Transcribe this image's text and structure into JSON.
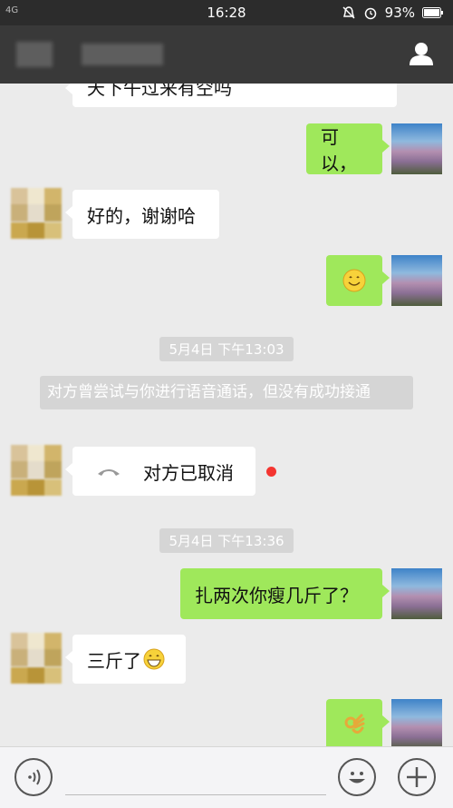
{
  "status_bar": {
    "time": "16:28",
    "battery": "93%",
    "network": "4G"
  },
  "messages": [
    {
      "side": "left",
      "text": "天下午过来有空吗"
    },
    {
      "side": "right",
      "text": "可以，"
    },
    {
      "side": "left",
      "text": "好的，谢谢哈"
    },
    {
      "side": "right",
      "emoji": "smile"
    },
    {
      "timestamp": "5月4日 下午13:03"
    },
    {
      "system": "对方曾尝试与你进行语音通话，但没有成功接通"
    },
    {
      "side": "left",
      "call": "对方已取消"
    },
    {
      "timestamp": "5月4日 下午13:36"
    },
    {
      "side": "right",
      "text": "扎两次你瘦几斤了？"
    },
    {
      "side": "left",
      "text": "三斤了"
    },
    {
      "side": "right",
      "emoji": "ok-hand"
    }
  ],
  "colors": {
    "bubble_green": "#9fe85b",
    "title_bar": "#393939",
    "unread_dot": "#f43530"
  }
}
